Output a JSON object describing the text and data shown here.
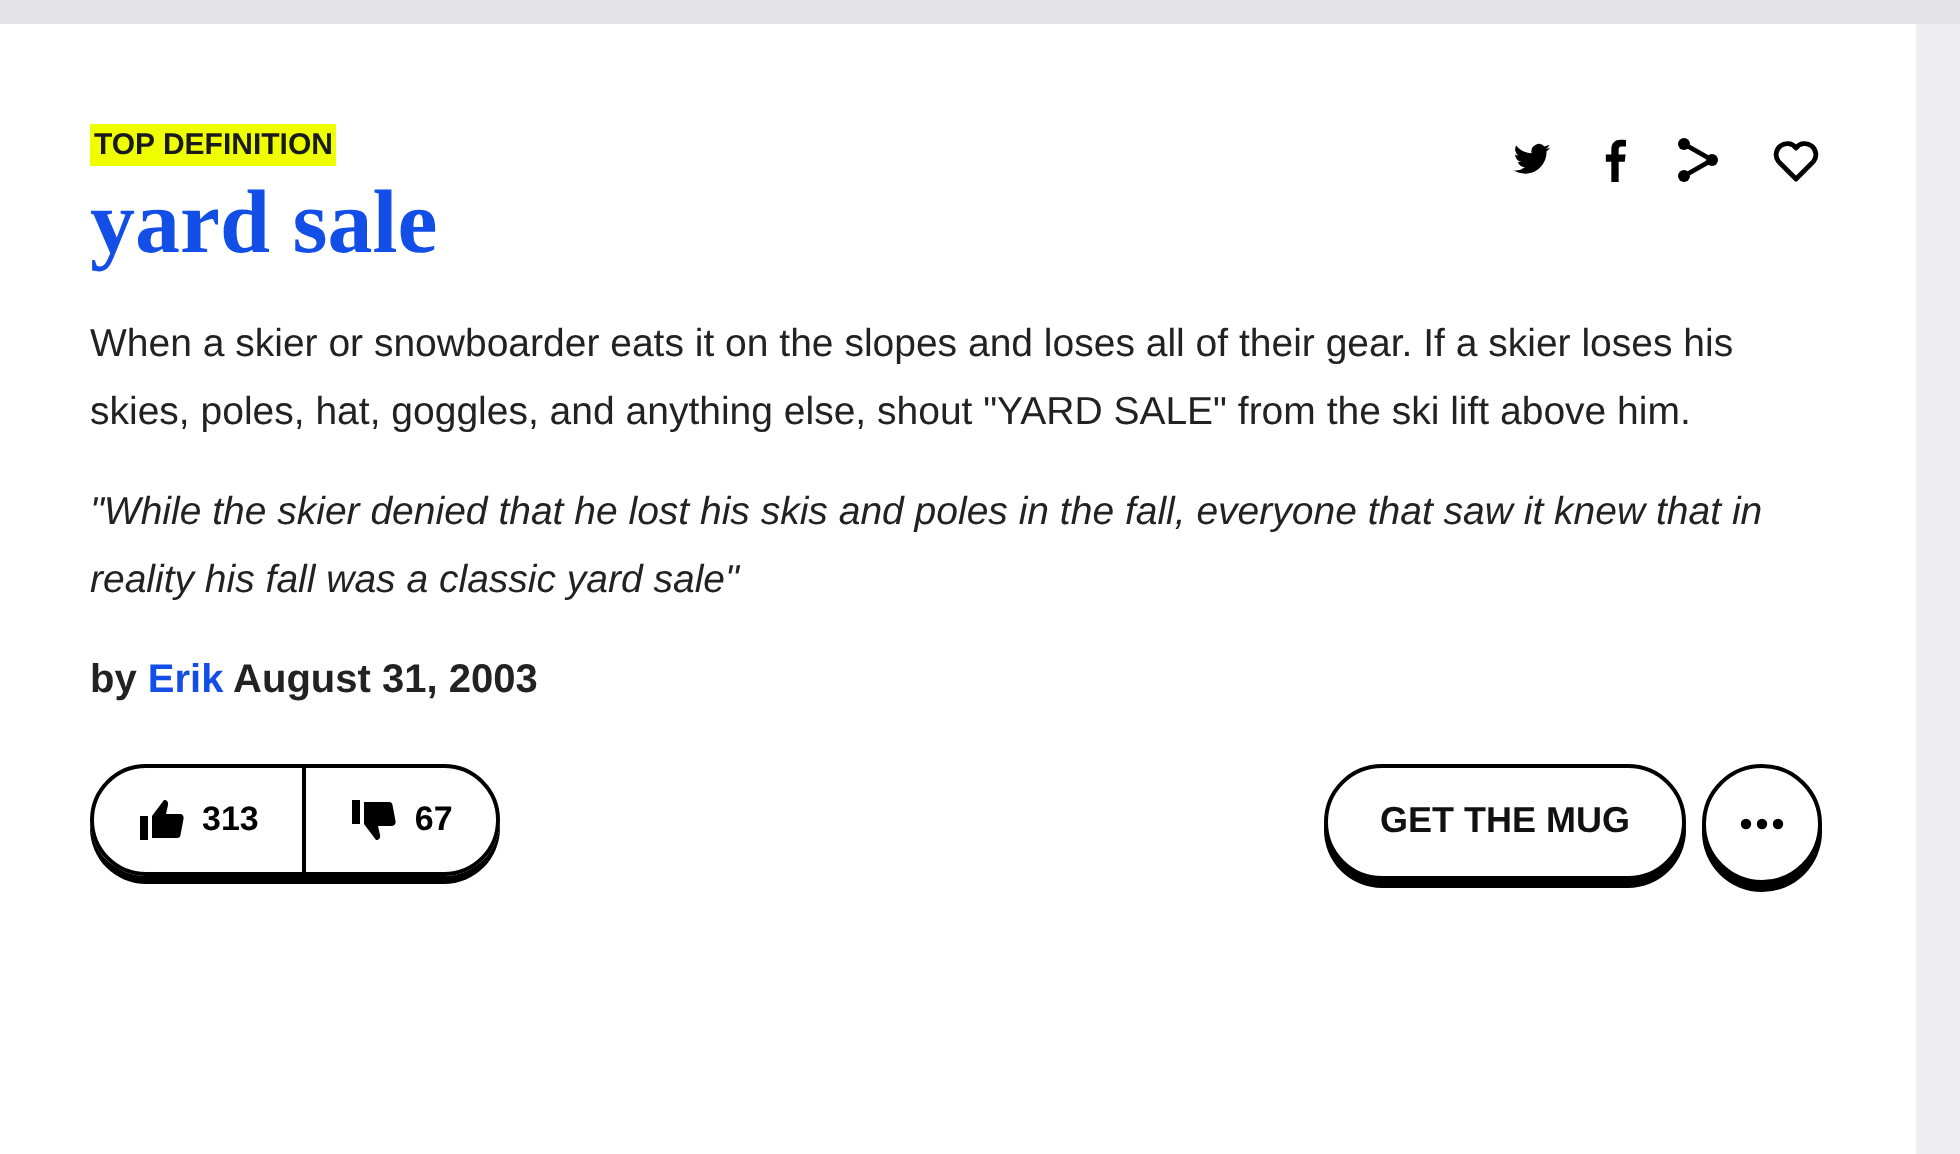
{
  "badge": "TOP DEFINITION",
  "word": "yard sale",
  "meaning": "When a skier or snowboarder eats it on the slopes and loses all of their gear. If a skier loses his skies, poles, hat, goggles, and anything else, shout \"YARD SALE\" from the ski lift above him.",
  "example": "\"While the skier denied that he lost his skis and poles in the fall, everyone that saw it knew that in reality his fall was a classic yard sale\"",
  "byline": {
    "prefix": "by",
    "author": "Erik",
    "date": "August 31, 2003"
  },
  "votes": {
    "up": "313",
    "down": "67"
  },
  "mug_button": "GET THE MUG"
}
